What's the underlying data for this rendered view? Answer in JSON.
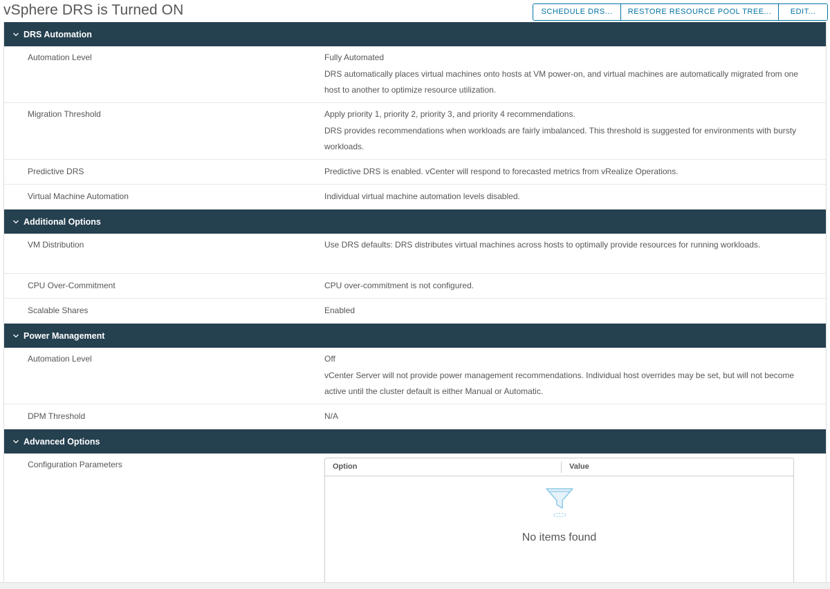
{
  "header": {
    "title": "vSphere DRS is Turned ON",
    "buttons": {
      "schedule": "SCHEDULE DRS...",
      "restore": "RESTORE RESOURCE POOL TREE...",
      "edit": "EDIT..."
    }
  },
  "sections": {
    "drs_automation": {
      "title": "DRS Automation",
      "automation_level": {
        "label": "Automation Level",
        "value_line1": "Fully Automated",
        "value_line2": "DRS automatically places virtual machines onto hosts at VM power-on, and virtual machines are automatically migrated from one host to another to optimize resource utilization."
      },
      "migration_threshold": {
        "label": "Migration Threshold",
        "value_line1": "Apply priority 1, priority 2, priority 3, and priority 4 recommendations.",
        "value_line2": "DRS provides recommendations when workloads are fairly imbalanced. This threshold is suggested for environments with bursty workloads."
      },
      "predictive_drs": {
        "label": "Predictive DRS",
        "value": "Predictive DRS is enabled. vCenter will respond to forecasted metrics from vRealize Operations."
      },
      "vm_automation": {
        "label": "Virtual Machine Automation",
        "value": "Individual virtual machine automation levels disabled."
      }
    },
    "additional_options": {
      "title": "Additional Options",
      "vm_distribution": {
        "label": "VM Distribution",
        "value": "Use DRS defaults: DRS distributes virtual machines across hosts to optimally provide resources for running workloads."
      },
      "cpu_overcommit": {
        "label": "CPU Over-Commitment",
        "value": "CPU over-commitment is not configured."
      },
      "scalable_shares": {
        "label": "Scalable Shares",
        "value": "Enabled"
      }
    },
    "power_management": {
      "title": "Power Management",
      "automation_level": {
        "label": "Automation Level",
        "value_line1": "Off",
        "value_line2": "vCenter Server will not provide power management recommendations. Individual host overrides may be set, but will not become active until the cluster default is either Manual or Automatic."
      },
      "dpm_threshold": {
        "label": "DPM Threshold",
        "value": "N/A"
      }
    },
    "advanced_options": {
      "title": "Advanced Options",
      "config_params": {
        "label": "Configuration Parameters",
        "columns": [
          "Option",
          "Value"
        ],
        "empty_message": "No items found"
      }
    }
  },
  "colors": {
    "section_header_bg": "#25404f",
    "accent": "#0072a3",
    "text": "#565656",
    "empty_icon": "#8cc8e6"
  },
  "icons": {
    "section_toggle": "chevron-down-icon",
    "empty_state": "funnel-filter-icon"
  }
}
